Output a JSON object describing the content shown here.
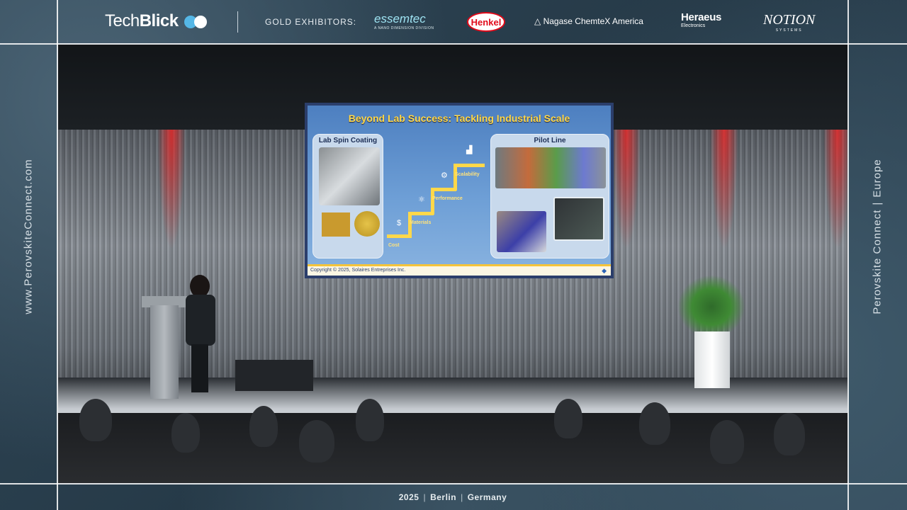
{
  "header": {
    "brand": {
      "part1": "Tech",
      "part2": "Blick"
    },
    "gold_label": "GOLD EXHIBITORS:",
    "sponsors": {
      "essemtec": {
        "name": "essemtec",
        "sub": "A NANO DIMENSION DIVISION"
      },
      "henkel": "Henkel",
      "nagase": "Nagase ChemteX America",
      "heraeus": {
        "name": "Heraeus",
        "sub": "Electronics"
      },
      "notion": {
        "name": "NOTION",
        "sub": "SYSTEMS"
      }
    }
  },
  "side_left": "www.PerovskiteConnect.com",
  "side_right": {
    "part1": "Perovskite Connect",
    "sep": "|",
    "part2": "Europe"
  },
  "footer": {
    "year": "2025",
    "city": "Berlin",
    "country": "Germany",
    "sep": "|"
  },
  "slide": {
    "title": "Beyond Lab Success: Tackling Industrial Scale",
    "left_panel_title": "Lab Spin Coating",
    "right_panel_title": "Pilot Line",
    "steps": [
      "Cost",
      "Materials",
      "Performance",
      "Scalability"
    ],
    "icons": [
      "dollar-icon",
      "atom-icon",
      "gears-icon",
      "chart-icon"
    ],
    "copyright": "Copyright © 2025, Solaires Entreprises Inc."
  },
  "colors": {
    "slide_title": "#ffd84a",
    "slide_bg": "#4d7fc0",
    "frame_bg": "#2a3f4e"
  }
}
